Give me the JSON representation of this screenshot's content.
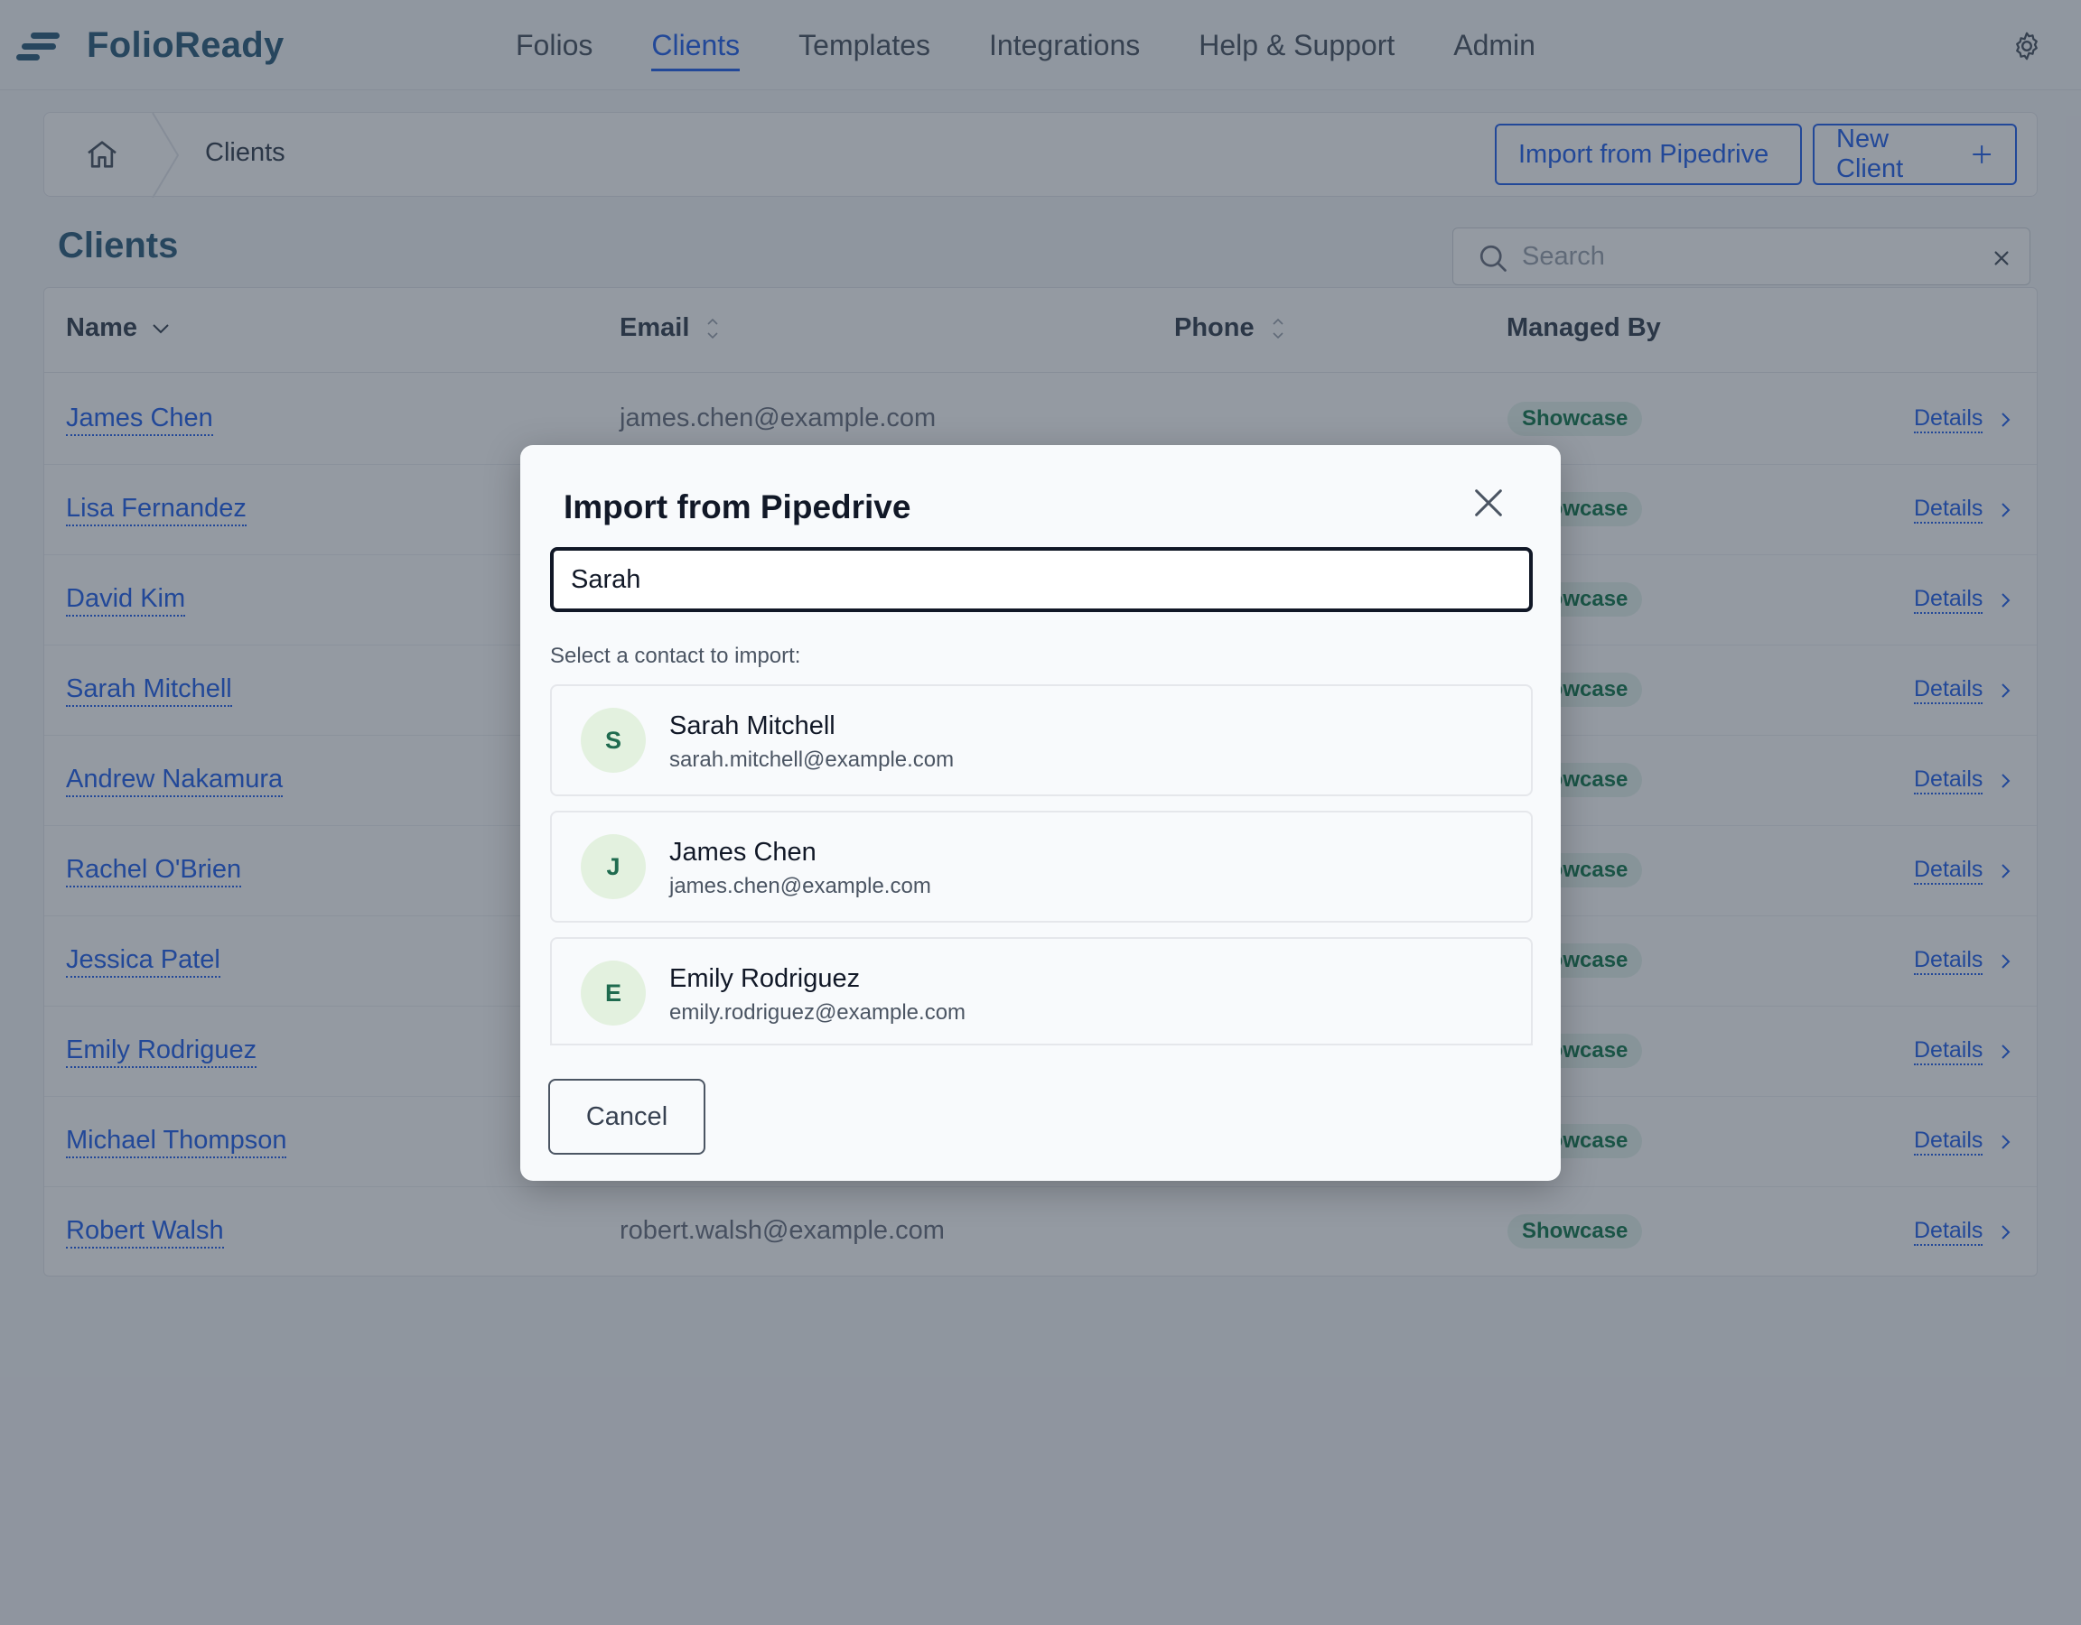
{
  "app": {
    "brand": "FolioReady"
  },
  "nav": {
    "items": [
      {
        "label": "Folios",
        "active": false
      },
      {
        "label": "Clients",
        "active": true
      },
      {
        "label": "Templates",
        "active": false
      },
      {
        "label": "Integrations",
        "active": false
      },
      {
        "label": "Help & Support",
        "active": false
      },
      {
        "label": "Admin",
        "active": false
      }
    ],
    "settings_icon": "gear-icon"
  },
  "breadcrumb": {
    "home_icon": "home-icon",
    "current": "Clients"
  },
  "actions": {
    "import_label": "Import from Pipedrive",
    "new_label": "New Client"
  },
  "page": {
    "title": "Clients",
    "search_placeholder": "Search"
  },
  "table": {
    "columns": [
      "Name",
      "Email",
      "Phone",
      "Managed By"
    ],
    "rows": [
      {
        "name": "James Chen",
        "email": "james.chen@example.com",
        "phone": "",
        "managed_by": "Showcase",
        "action": "Details"
      },
      {
        "name": "Lisa Fernandez",
        "email": "",
        "phone": "",
        "managed_by": "Showcase",
        "action": "Details"
      },
      {
        "name": "David Kim",
        "email": "",
        "phone": "",
        "managed_by": "Showcase",
        "action": "Details"
      },
      {
        "name": "Sarah Mitchell",
        "email": "",
        "phone": "",
        "managed_by": "Showcase",
        "action": "Details"
      },
      {
        "name": "Andrew Nakamura",
        "email": "",
        "phone": "",
        "managed_by": "Showcase",
        "action": "Details"
      },
      {
        "name": "Rachel O'Brien",
        "email": "",
        "phone": "",
        "managed_by": "Showcase",
        "action": "Details"
      },
      {
        "name": "Jessica Patel",
        "email": "",
        "phone": "",
        "managed_by": "Showcase",
        "action": "Details"
      },
      {
        "name": "Emily Rodriguez",
        "email": "",
        "phone": "",
        "managed_by": "Showcase",
        "action": "Details"
      },
      {
        "name": "Michael Thompson",
        "email": "",
        "phone": "",
        "managed_by": "Showcase",
        "action": "Details"
      },
      {
        "name": "Robert Walsh",
        "email": "robert.walsh@example.com",
        "phone": "",
        "managed_by": "Showcase",
        "action": "Details"
      }
    ]
  },
  "modal": {
    "title": "Import from Pipedrive",
    "search_value": "Sarah",
    "prompt": "Select a contact to import:",
    "contacts": [
      {
        "initial": "S",
        "name": "Sarah Mitchell",
        "email": "sarah.mitchell@example.com"
      },
      {
        "initial": "J",
        "name": "James Chen",
        "email": "james.chen@example.com"
      },
      {
        "initial": "E",
        "name": "Emily Rodriguez",
        "email": "emily.rodriguez@example.com"
      }
    ],
    "cancel_label": "Cancel"
  },
  "colors": {
    "accent": "#2563eb",
    "brand": "#2f5f7d",
    "badge_bg": "#e6f4ee",
    "badge_text": "#16794f",
    "avatar_bg": "#e3f1df"
  }
}
